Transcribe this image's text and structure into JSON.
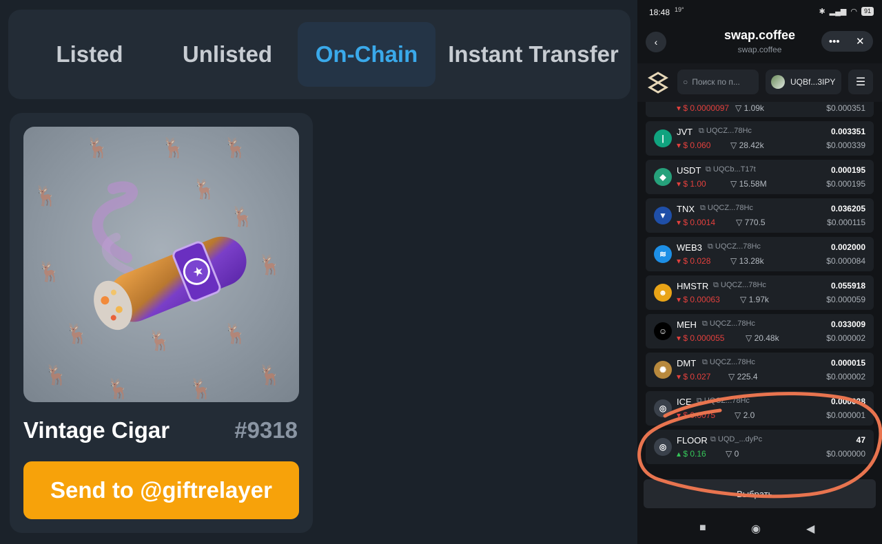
{
  "tabs": [
    {
      "label": "Listed"
    },
    {
      "label": "Unlisted"
    },
    {
      "label": "On-Chain"
    },
    {
      "label": "Instant Transfer"
    }
  ],
  "active_tab": "On-Chain",
  "gift": {
    "name": "Vintage Cigar",
    "number": "#9318",
    "send_label": "Send to @giftrelayer"
  },
  "phone": {
    "status": {
      "time": "18:48",
      "temp": "19°",
      "battery": "91"
    },
    "app_title": "swap.coffee",
    "app_subtitle": "swap.coffee",
    "search_placeholder": "Поиск по п...",
    "wallet": "UQBf...3IPY",
    "partial_row": {
      "price": "$ 0.0000097",
      "liq": "1.09k",
      "usd": "$0.000351"
    },
    "tokens": [
      {
        "symbol": "JVT",
        "address": "UQCZ...78Hc",
        "price": "$ 0.060",
        "trend": "down",
        "liq": "28.42k",
        "amount": "0.003351",
        "usd": "$0.000339",
        "icon": "JVT-icon",
        "color": "#10a37f"
      },
      {
        "symbol": "USDT",
        "address": "UQCb...T17t",
        "price": "$ 1.00",
        "trend": "down",
        "liq": "15.58M",
        "amount": "0.000195",
        "usd": "$0.000195",
        "icon": "tether-icon",
        "color": "#26a17b"
      },
      {
        "symbol": "TNX",
        "address": "UQCZ...78Hc",
        "price": "$ 0.0014",
        "trend": "down",
        "liq": "770.5",
        "amount": "0.036205",
        "usd": "$0.000115",
        "icon": "diamond-icon",
        "color": "#1f4fa8"
      },
      {
        "symbol": "WEB3",
        "address": "UQCZ...78Hc",
        "price": "$ 0.028",
        "trend": "down",
        "liq": "13.28k",
        "amount": "0.002000",
        "usd": "$0.000084",
        "icon": "web3-icon",
        "color": "#1d8fe6"
      },
      {
        "symbol": "HMSTR",
        "address": "UQCZ...78Hc",
        "price": "$ 0.00063",
        "trend": "down",
        "liq": "1.97k",
        "amount": "0.055918",
        "usd": "$0.000059",
        "icon": "hamster-icon",
        "color": "#e9a417"
      },
      {
        "symbol": "MEH",
        "address": "UQCZ...78Hc",
        "price": "$ 0.000055",
        "trend": "down",
        "liq": "20.48k",
        "amount": "0.033009",
        "usd": "$0.000002",
        "icon": "meh-face-icon",
        "color": "#000000"
      },
      {
        "symbol": "DMT",
        "address": "UQCZ...78Hc",
        "price": "$ 0.027",
        "trend": "down",
        "liq": "225.4",
        "amount": "0.000015",
        "usd": "$0.000002",
        "icon": "dmt-icon",
        "color": "#b8893d"
      },
      {
        "symbol": "ICE",
        "address": "UQCZ...78Hc",
        "price": "$ 0.0075",
        "trend": "down",
        "liq": "2.0",
        "amount": "0.000038",
        "usd": "$0.000001",
        "icon": "placeholder-token-icon",
        "color": "#3a414b"
      },
      {
        "symbol": "FLOOR",
        "address": "UQD_...dyPc",
        "price": "$ 0.16",
        "trend": "up",
        "liq": "0",
        "amount": "47",
        "usd": "$0.000000",
        "icon": "placeholder-token-icon",
        "color": "#3a414b"
      }
    ],
    "select_label": "Выбрать ...",
    "annotation_color": "#e8744f"
  }
}
